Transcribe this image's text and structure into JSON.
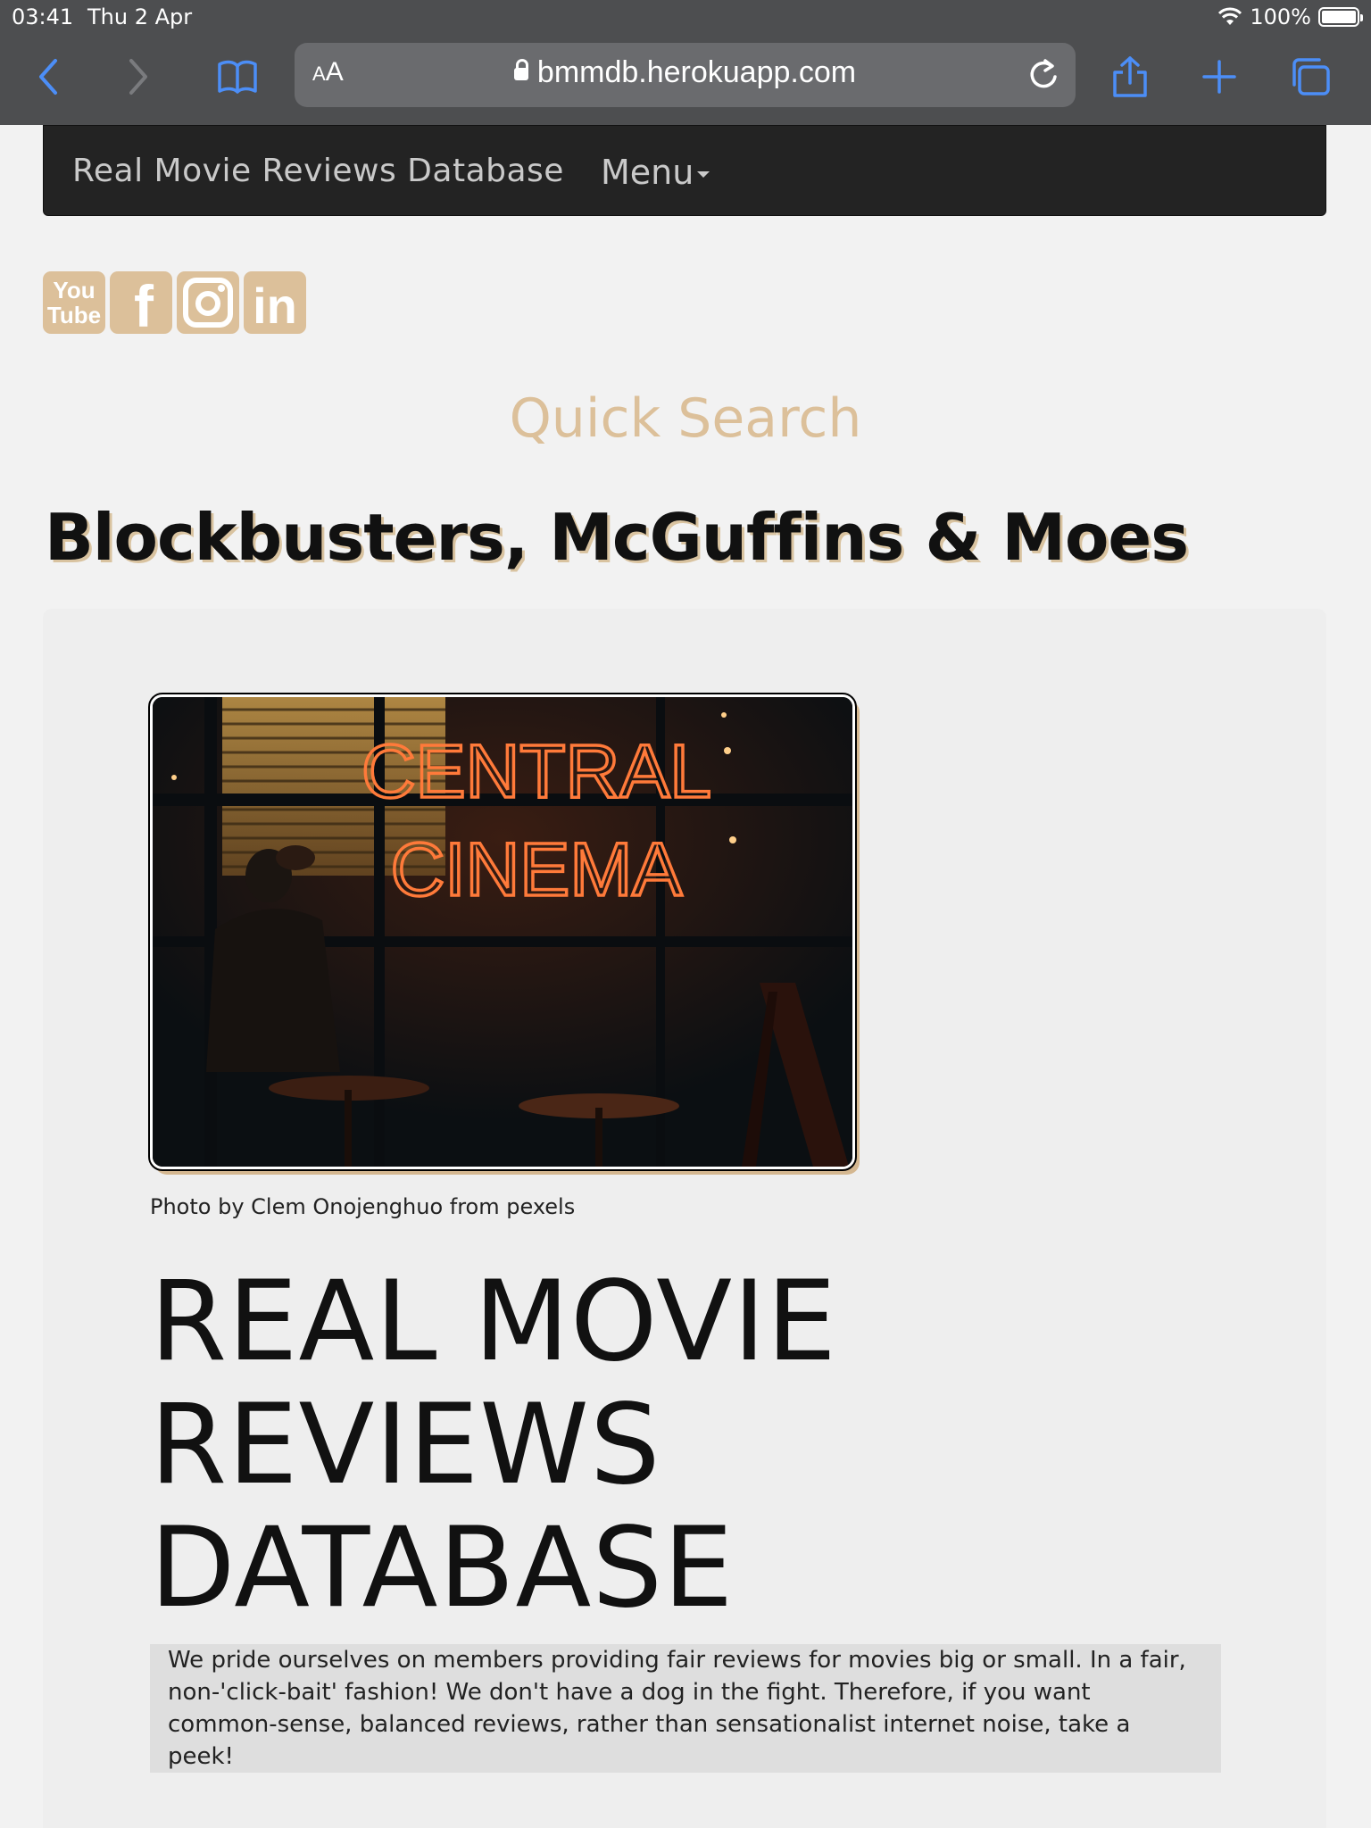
{
  "status_bar": {
    "time": "03:41",
    "date": "Thu 2 Apr",
    "battery": "100%",
    "battery_level": 1.0
  },
  "browser": {
    "aa_label_small": "A",
    "aa_label_large": "A",
    "url": "bmmdb.herokuapp.com",
    "accent_color": "#4c8ef7",
    "icons": [
      "back-icon",
      "forward-icon",
      "bookmarks-icon",
      "lock-icon",
      "reload-icon",
      "share-icon",
      "new-tab-icon",
      "tabs-icon",
      "wifi-icon",
      "battery-icon"
    ]
  },
  "navbar": {
    "brand": "Real Movie Reviews Database",
    "menu": "Menu"
  },
  "social": {
    "color": "#dcc09a",
    "items": [
      {
        "name": "youtube-icon",
        "line1": "You",
        "line2": "Tube"
      },
      {
        "name": "facebook-icon",
        "glyph": "f"
      },
      {
        "name": "instagram-icon"
      },
      {
        "name": "linkedin-icon",
        "glyph": "in"
      }
    ]
  },
  "quick_search": {
    "label_first": "Q",
    "label_rest": "uick Search"
  },
  "site_title": "Blockbusters, McGuffins & Moes",
  "hero": {
    "photo_sign_line1": "CENTRAL",
    "photo_sign_line2": "CINEMA",
    "photo_credit": "Photo by Clem Onojenghuo from pexels",
    "title_lines": [
      "REAL MOVIE",
      "REVIEWS",
      "DATABASE"
    ],
    "lead": "We pride ourselves on members providing fair reviews for movies big or small. In a fair, non-'click-bait' fashion! We don't have a dog in the fight. Therefore, if you want common-sense, balanced reviews, rather than sensationalist internet noise, take a peek!"
  }
}
